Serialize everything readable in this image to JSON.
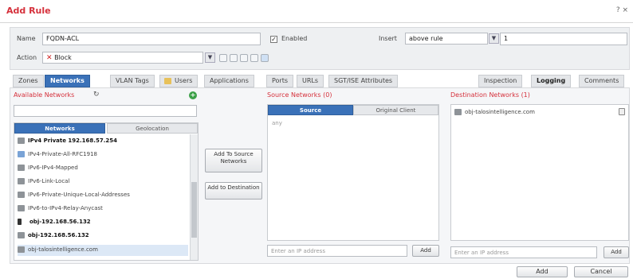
{
  "dialog": {
    "title": "Add Rule",
    "window_controls": "? ×"
  },
  "form": {
    "name_label": "Name",
    "name_value": "FQDN-ACL",
    "enabled_label": "Enabled",
    "insert_label": "Insert",
    "insert_value": "above rule",
    "insert_rule_number": "1",
    "action_label": "Action",
    "action_value": "Block"
  },
  "tabs": [
    "Zones",
    "Networks",
    "VLAN Tags",
    "Users",
    "Applications",
    "Ports",
    "URLs",
    "SGT/ISE Attributes",
    "Inspection",
    "Logging",
    "Comments"
  ],
  "available": {
    "title": "Available Networks",
    "search_value": "",
    "subtabs": [
      "Networks",
      "Geolocation"
    ],
    "items": [
      "IPv4 Private 192.168.57.254",
      "IPv4-Private-All-RFC1918",
      "IPv6-IPv4-Mapped",
      "IPv6-Link-Local",
      "IPv6-Private-Unique-Local-Addresses",
      "IPv6-to-IPv4-Relay-Anycast",
      "obj-192.168.56.132",
      "obj-192.168.56.132",
      "obj-talosintelligence.com"
    ]
  },
  "middle_buttons": {
    "add_source": "Add To Source Networks",
    "add_destination": "Add to Destination"
  },
  "source": {
    "title": "Source Networks (0)",
    "subtabs": [
      "Source",
      "Original Client"
    ],
    "placeholder_item": "any",
    "ip_placeholder": "Enter an IP address",
    "add_label": "Add"
  },
  "destination": {
    "title": "Destination Networks (1)",
    "items": [
      "obj-talosintelligence.com"
    ],
    "ip_placeholder": "Enter an IP address",
    "add_label": "Add"
  },
  "footer": {
    "add_label": "Add",
    "cancel_label": "Cancel"
  },
  "colors": {
    "accent": "#d5303b",
    "tab_active": "#3a71b8"
  },
  "icons": [
    "refresh-icon",
    "add-green-icon",
    "block-icon",
    "network-object-icon",
    "delete-icon"
  ]
}
